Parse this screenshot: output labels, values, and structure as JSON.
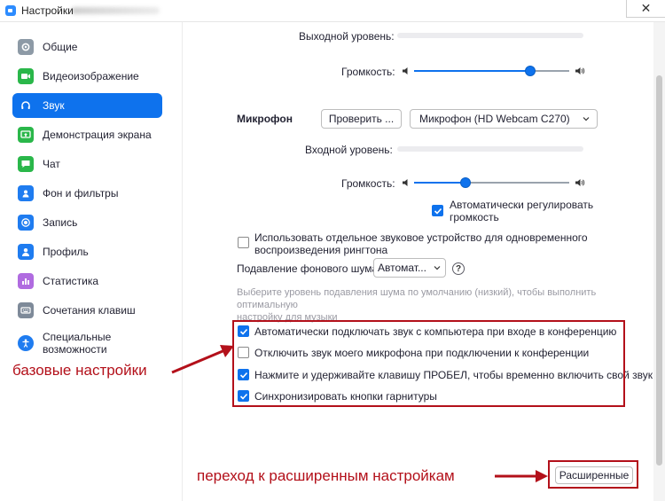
{
  "window": {
    "title": "Настройки",
    "close_symbol": "✕"
  },
  "sidebar": {
    "items": [
      {
        "label": "Общие",
        "icon": "gear-icon"
      },
      {
        "label": "Видеоизображение",
        "icon": "video-camera-icon"
      },
      {
        "label": "Звук",
        "icon": "headphones-icon",
        "active": true
      },
      {
        "label": "Демонстрация экрана",
        "icon": "screen-share-icon"
      },
      {
        "label": "Чат",
        "icon": "chat-bubble-icon"
      },
      {
        "label": "Фон и фильтры",
        "icon": "person-background-icon"
      },
      {
        "label": "Запись",
        "icon": "record-icon"
      },
      {
        "label": "Профиль",
        "icon": "profile-icon"
      },
      {
        "label": "Статистика",
        "icon": "bar-chart-icon"
      },
      {
        "label": "Сочетания клавиш",
        "icon": "keyboard-icon"
      },
      {
        "label_line1": "Специальные",
        "label_line2": "возможности",
        "icon": "accessibility-icon"
      }
    ]
  },
  "speaker": {
    "output_level_label": "Выходной уровень:",
    "volume_label": "Громкость:",
    "volume_fraction": 0.75
  },
  "microphone": {
    "section_label": "Микрофон",
    "test_button": "Проверить ...",
    "device_selected": "Микрофон (HD Webcam C270)",
    "input_level_label": "Входной уровень:",
    "volume_label": "Громкость:",
    "volume_fraction": 0.33,
    "auto_adjust_line1": "Автоматически регулировать",
    "auto_adjust_line2": "громкость",
    "auto_adjust_checked": true
  },
  "ringtone": {
    "line1": "Использовать отдельное звуковое устройство для одновременного",
    "line2": "воспроизведения рингтона",
    "checked": false
  },
  "noise": {
    "label": "Подавление фонового шума",
    "selected": "Автомат...",
    "help_symbol": "?",
    "hint_line1": "Выберите уровень подавления шума по умолчанию (низкий), чтобы выполнить оптимальную",
    "hint_line2": "настройку для музыки"
  },
  "basic_options": [
    {
      "label": "Автоматически подключать звук с компьютера при входе в конференцию",
      "checked": true
    },
    {
      "label": "Отключить звук моего микрофона при подключении к конференции",
      "checked": false
    },
    {
      "label": "Нажмите и удерживайте клавишу ПРОБЕЛ, чтобы временно включить свой звук",
      "checked": true
    },
    {
      "label": "Синхронизировать кнопки гарнитуры",
      "checked": true
    }
  ],
  "advanced_button": "Расширенные",
  "annotations": {
    "basic": "базовые настройки",
    "advanced": "переход к расширенным настройкам",
    "color": "#b3101a"
  },
  "colors": {
    "accent": "#0e72ed"
  }
}
